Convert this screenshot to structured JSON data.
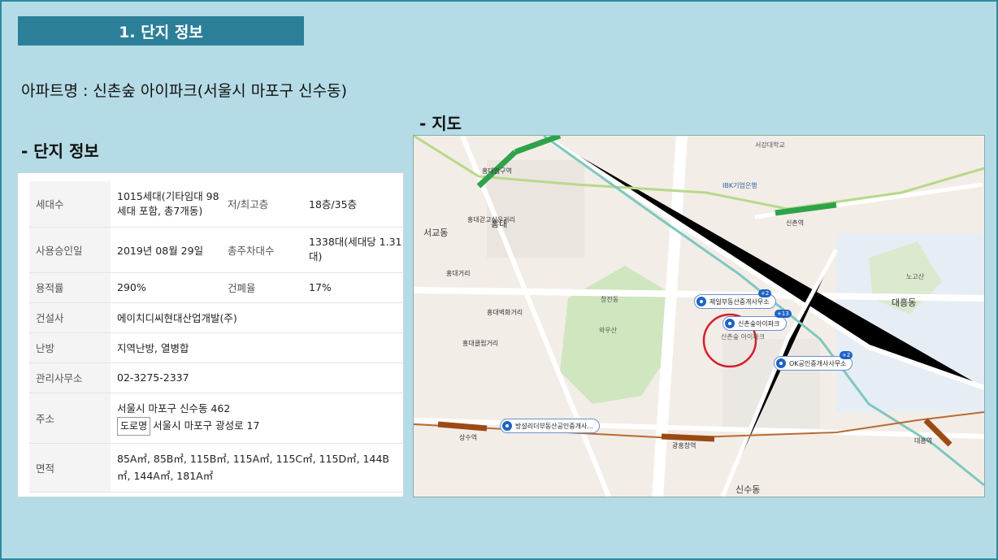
{
  "banner": "1. 단지 정보",
  "apartment_title": "아파트명 : 신촌숲 아이파크(서울시 마포구 신수동)",
  "info_heading": "- 단지 정보",
  "map_heading": "- 지도",
  "table": {
    "households_label": "세대수",
    "households_value": "1015세대(기타임대 98세대 포함, 총7개동)",
    "floors_label": "저/최고층",
    "floors_value": "18층/35층",
    "approval_label": "사용승인일",
    "approval_value": "2019년 08월 29일",
    "parking_label": "총주차대수",
    "parking_value": "1338대(세대당 1.31대)",
    "far_label": "용적률",
    "far_value": "290%",
    "bcr_label": "건폐율",
    "bcr_value": "17%",
    "builder_label": "건설사",
    "builder_value": "에이치디씨현대산업개발(주)",
    "heating_label": "난방",
    "heating_value": "지역난방, 열병합",
    "office_label": "관리사무소",
    "office_value": "02-3275-2337",
    "address_label": "주소",
    "address_jibun": "서울시 마포구 신수동 462",
    "address_road_tag": "도로명",
    "address_road": "서울시 마포구 광성로 17",
    "area_label": "면적",
    "area_value": "85A㎡, 85B㎡, 115B㎡, 115A㎡, 115C㎡, 115D㎡, 144B㎡, 144A㎡, 181A㎡"
  },
  "map": {
    "places": {
      "hongik_univ": "홍대입구역",
      "sinchon_station": "신촌역",
      "hongdae": "홍대",
      "hongdae_street": "홍대걷고싶은거리",
      "hongdae_walk": "홍대거리",
      "hongdae_mall": "홍대벽화거리",
      "hongdae_club": "홍대클럽거리",
      "seogyo": "서교동",
      "wausan": "와우산",
      "sinsu": "신수동",
      "daeheung": "대흥동",
      "gwangheungchang": "광흥창역",
      "daeheung_station": "대흥역",
      "sangsu": "상수역",
      "changjeon": "창전동",
      "noksan": "노고산",
      "ibk": "IBK기업은행",
      "seogang_univ": "서강대학교",
      "sogang": "서강",
      "sinchon_forest": "신촌숲 아이파크",
      "sinchon_forest_label": "신촌숲아이파크"
    },
    "pins": {
      "agent1": "제일부동산중개사무소",
      "agent1_count": "+2",
      "agent2": "신촌숲아이파크",
      "agent2_count": "+13",
      "agent3": "OK공인중개사사무소",
      "agent3_count": "+2",
      "agent4": "방설리더부동산공인중개사..."
    }
  }
}
